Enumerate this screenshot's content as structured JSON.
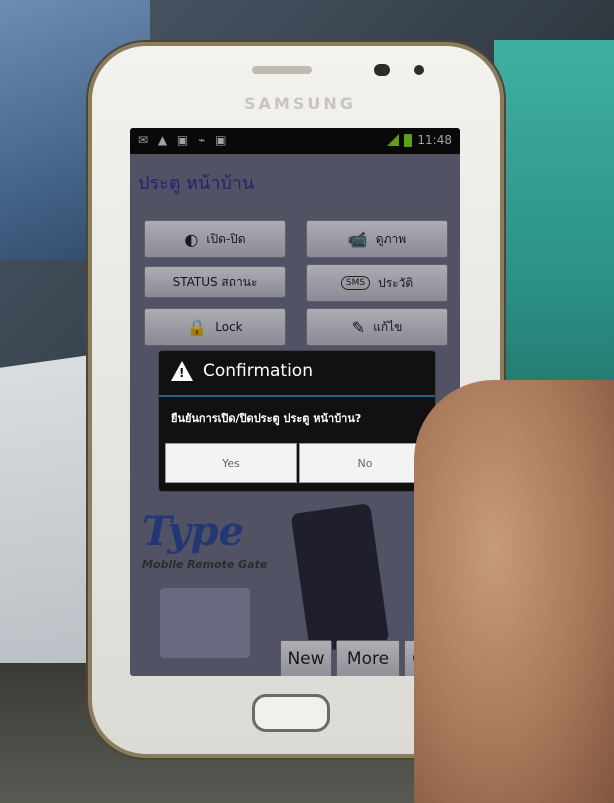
{
  "phone": {
    "brand": "SAMSUNG"
  },
  "status_bar": {
    "time": "11:48"
  },
  "app": {
    "title": "ประตู หน้าบ้าน",
    "buttons": [
      {
        "label": "เปิด-ปิด",
        "icon": "dimmer-icon"
      },
      {
        "label": "ดูภาพ",
        "icon": "camera-icon"
      },
      {
        "label": "STATUS สถานะ",
        "icon": ""
      },
      {
        "label": "ประวัติ",
        "icon": "sms-icon",
        "icon_text": "SMS"
      },
      {
        "label": "Lock",
        "icon": "lock-icon"
      },
      {
        "label": "แก้ไข",
        "icon": "pencil-icon"
      }
    ],
    "logo_text": "Type",
    "logo_sub": "Mobile Remote Gate",
    "bottom_buttons": {
      "new": "New",
      "more": "More",
      "quit": "Quit"
    }
  },
  "dialog": {
    "title": "Confirmation",
    "message": "ยืนยันการเปิด/ปิดประตู ประตู หน้าบ้าน?",
    "yes": "Yes",
    "no": "No"
  }
}
